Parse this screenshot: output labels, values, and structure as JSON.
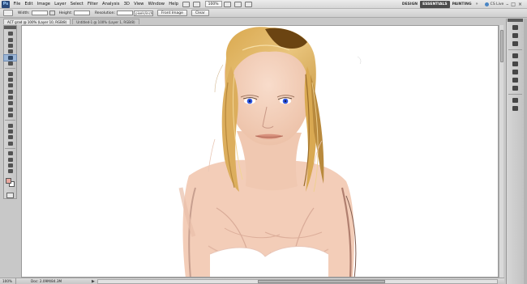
{
  "app": {
    "logo": "Ps",
    "zoom_label": "100%"
  },
  "menu": {
    "items": [
      "File",
      "Edit",
      "Image",
      "Layer",
      "Select",
      "Filter",
      "Analysis",
      "3D",
      "View",
      "Window",
      "Help"
    ]
  },
  "workspaces": {
    "items": [
      "DESIGN",
      "ESSENTIALS",
      "PAINTING"
    ],
    "active": "ESSENTIALS",
    "more": "»",
    "cs_live": "CS Live"
  },
  "window_controls": {
    "minimize": "–",
    "restore": "□",
    "close": "×"
  },
  "options_bar": {
    "width_label": "Width:",
    "height_label": "Height:",
    "resolution_label": "Resolution:",
    "resolution_unit": "pixels/inch",
    "front_image_label": "Front Image",
    "clear_label": "Clear"
  },
  "tabs": [
    {
      "label": "ACT grad @ 100% (Layer 10, RGB/8)",
      "active": true
    },
    {
      "label": "Untitled-1 @ 100% (Layer 1, RGB/8)",
      "active": false
    }
  ],
  "status": {
    "zoom": "100%",
    "doc": "Doc: 2.09M/84.3M",
    "arrow": "▶"
  },
  "colors": {
    "foreground": "#e8a79e",
    "background": "#ffffff",
    "hair_light": "#e2b86a",
    "hair_dark": "#6b4412",
    "skin": "#f3cdb8",
    "iris": "#2f56e0"
  }
}
